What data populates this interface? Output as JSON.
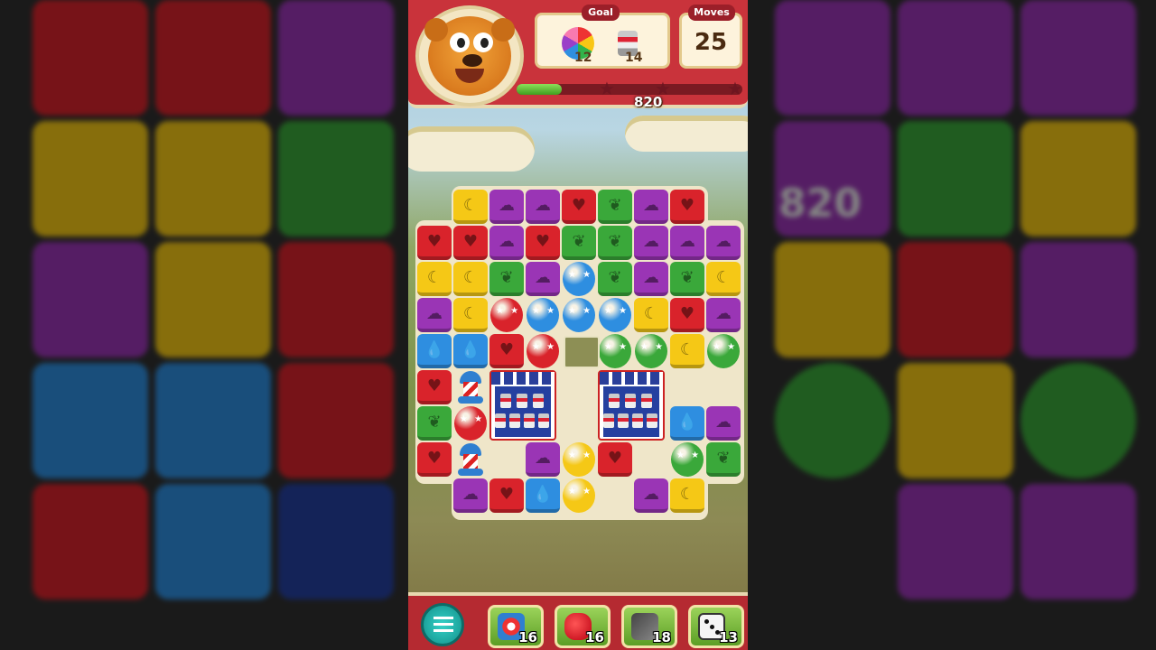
{
  "header": {
    "goal_label": "Goal",
    "goal_items": [
      {
        "icon": "rainbow-balloon-icon",
        "count": "12"
      },
      {
        "icon": "paint-can-icon",
        "count": "14"
      }
    ],
    "moves_label": "Moves",
    "moves_value": "25",
    "level_progress": 0.2
  },
  "board": {
    "score_popup": "820"
  },
  "toolbar": {
    "menu_icon": "menu-list-icon",
    "boosters": [
      {
        "icon": "hammer-icon",
        "count": "16"
      },
      {
        "icon": "boxing-glove-icon",
        "count": "16"
      },
      {
        "icon": "drill-icon",
        "count": "18"
      },
      {
        "icon": "dice-icon",
        "count": "13"
      }
    ]
  },
  "background": {
    "side_blur_score": "820"
  },
  "colors": {
    "red": "#d9232b",
    "yellow": "#f5c816",
    "green": "#3aa83a",
    "purple": "#9a35b5",
    "blue": "#2e8ee0",
    "header": "#c9333b"
  }
}
